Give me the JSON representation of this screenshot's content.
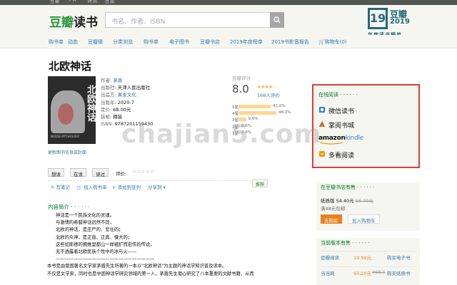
{
  "topbar": {
    "links": [
      "豆瓣",
      "FM",
      "时间",
      "豆品"
    ]
  },
  "header": {
    "logo_brand": "豆瓣",
    "logo_suffix": "读书",
    "search_placeholder": "书名、作者、ISBN",
    "badge": {
      "num": "19",
      "brand": "豆瓣",
      "year": "2019",
      "caption": "年度读书榜单"
    }
  },
  "nav": {
    "items": [
      "购书单",
      "动态",
      "豆瓣猜",
      "分类浏览",
      "购书单",
      "电子图书",
      "豆瓣书店",
      "2019年度榜单",
      "2019书影音报告",
      "购物车(0)"
    ]
  },
  "book": {
    "title": "北欧神话",
    "cover_title": "北欧神话",
    "cover_en": "NORSE MYTHOLOGY",
    "cover_link": "更新图书信息或封面",
    "info": [
      {
        "k": "作者:",
        "v": "茅盾"
      },
      {
        "k": "出版社:",
        "v": "天津人民出版社"
      },
      {
        "k": "出品方:",
        "v": "果麦文化"
      },
      {
        "k": "出版年:",
        "v": "2020-7"
      },
      {
        "k": "定价:",
        "v": "68.00元"
      },
      {
        "k": "装帧:",
        "v": "精装"
      },
      {
        "k": "ISBN:",
        "v": "9787201159430"
      }
    ]
  },
  "rating": {
    "label": "豆瓣评分",
    "score": "8.0",
    "stars": "★★★★☆",
    "count": "166人评价",
    "dist": [
      {
        "star": "5星",
        "pct": 41.0,
        "label": "41.0%"
      },
      {
        "star": "4星",
        "pct": 48.2,
        "label": "48.2%"
      },
      {
        "star": "3星",
        "pct": 9.6,
        "label": "9.6%"
      },
      {
        "star": "2星",
        "pct": 0.6,
        "label": "0.6%"
      },
      {
        "star": "1星",
        "pct": 0.6,
        "label": "0.6%"
      }
    ]
  },
  "actions": {
    "want": "想读",
    "reading": "在读",
    "read": "读过",
    "rate": "评价:",
    "rate_stars": "☆☆☆☆☆"
  },
  "tools": {
    "note": "写笔记",
    "booklist": "加入购书单",
    "doulist": "添加到豆列",
    "share": "分享到",
    "recommend": "推荐"
  },
  "intro": {
    "title": "内容简介 · · · · · ·",
    "lines": [
      "神话是一个民族文化的灵魂。",
      "与激情的希腊神话迥然不同，",
      "北欧的神话，是庄严的、悲壮的；",
      "北欧的众神，是正直、正真、慷大的；",
      "这些如斯德的拥推里都山一样粗犷而宏伟的传说，",
      "无不透露着北欧民族个性中的冰与火——",
      "——————————————————————",
      "本书是由我国著名文学家茅盾先生所著的一本以\"北欧神话\"为主题的神话学知识普及读本。",
      "不仅是文学家，同时也是中国神话学研究领域的第一人，茅盾先生潜心研究了八本重要的文献书籍，从而"
    ]
  },
  "online": {
    "title": "在线阅读 · · · · · ·",
    "items": [
      {
        "name": "微信读书",
        "icon": "weread-icon",
        "color": "#2a7be4"
      },
      {
        "name": "掌阅书城",
        "icon": "ireader-icon",
        "color": "#e2432b"
      },
      {
        "name": "amazonkindle",
        "icon": "kindle-icon",
        "color": "#111111"
      },
      {
        "name": "多看阅读",
        "icon": "duokan-icon",
        "color": "#f39800"
      }
    ]
  },
  "store": {
    "title": "在豆瓣书店有售 · · · · · ·",
    "paper_label": "纸质版",
    "price": "54.40元",
    "old_price": "68.00元",
    "note": "满48元包邮",
    "buy": "去购买",
    "cart": "加入购物车"
  },
  "versions": {
    "title": "当前版本有售 · · · · · ·",
    "rows": [
      {
        "shop": "豆瓣阅读",
        "price": "19.99元",
        "action": "购买电子书"
      },
      {
        "shop": "当当网",
        "price": "65.20元",
        "old": "¥68.0",
        "action": "购买纸质书"
      }
    ]
  },
  "watermark": "chajian5.com"
}
